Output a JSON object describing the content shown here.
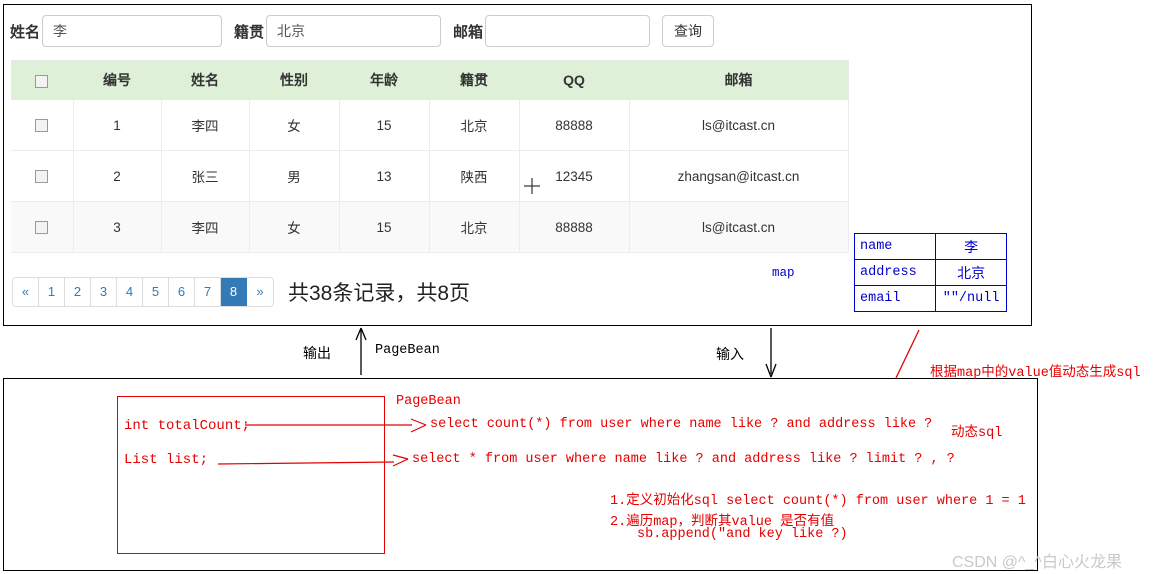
{
  "search": {
    "name_label": "姓名",
    "name_value": "李",
    "address_label": "籍贯",
    "address_value": "北京",
    "email_label": "邮箱",
    "email_value": "",
    "query_button": "查询"
  },
  "table": {
    "headers": [
      "",
      "编号",
      "姓名",
      "性别",
      "年龄",
      "籍贯",
      "QQ",
      "邮箱"
    ],
    "rows": [
      {
        "id": "1",
        "name": "李四",
        "sex": "女",
        "age": "15",
        "address": "北京",
        "qq": "88888",
        "email": "ls@itcast.cn"
      },
      {
        "id": "2",
        "name": "张三",
        "sex": "男",
        "age": "13",
        "address": "陕西",
        "qq": "12345",
        "email": "zhangsan@itcast.cn"
      },
      {
        "id": "3",
        "name": "李四",
        "sex": "女",
        "age": "15",
        "address": "北京",
        "qq": "88888",
        "email": "ls@itcast.cn"
      }
    ]
  },
  "pagination": {
    "prev": "«",
    "pages": [
      "1",
      "2",
      "3",
      "4",
      "5",
      "6",
      "7",
      "8"
    ],
    "active_page": "8",
    "next": "»",
    "summary": "共38条记录，共8页",
    "accent_color": "#337ab7"
  },
  "map_panel": {
    "label": "map",
    "rows": [
      {
        "key": "name",
        "value": "李"
      },
      {
        "key": "address",
        "value": "北京"
      },
      {
        "key": "email",
        "value": "\"\"/null"
      }
    ],
    "color": "#0000cc"
  },
  "flow": {
    "output_label": "输出",
    "input_label": "输入",
    "pagebean_label": "PageBean"
  },
  "diagram": {
    "pagebean_title": "PageBean",
    "field_total_count": "int totalCount;",
    "field_list": "List list;",
    "sql_count": "select count(*) from user where name like ? and address like ?",
    "sql_list": "select * from user where name like ? and address like ? limit ? , ?",
    "dynamic_sql_label": "动态sql",
    "dynamic_gen_note": "根据map中的value值动态生成sql",
    "note_1": "1.定义初始化sql select count(*) from user where 1 = 1",
    "note_2": "2.遍历map，判断其value 是否有值",
    "note_2b": "sb.append(\"and  key like ?)",
    "red_color": "#e60000"
  },
  "watermark": {
    "text": "CSDN @^_^白心火龙果"
  }
}
